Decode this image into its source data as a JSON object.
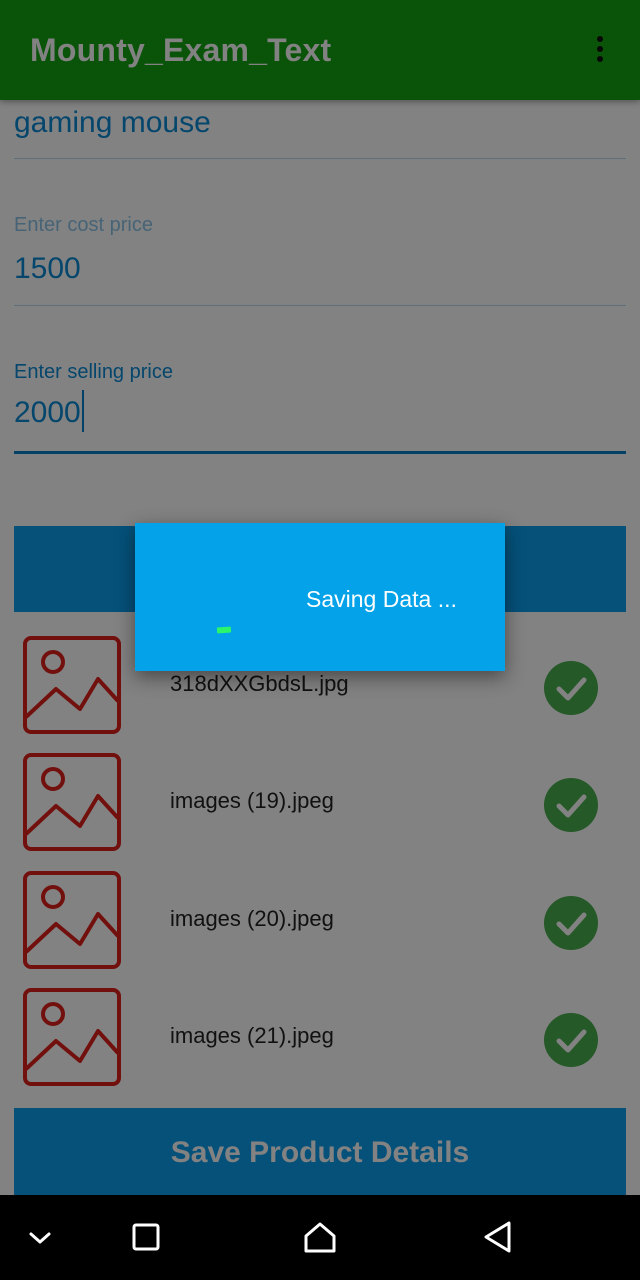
{
  "app_bar": {
    "title": "Mounty_Exam_Text",
    "menu_icon": "more-vert-icon"
  },
  "form": {
    "product_name": {
      "value": "gaming mouse"
    },
    "cost_price": {
      "hint": "Enter cost price",
      "value": "1500"
    },
    "selling_price": {
      "label": "Enter selling price",
      "value": "2000"
    }
  },
  "images": [
    {
      "file": "318dXXGbdsL.jpg",
      "status": "uploaded"
    },
    {
      "file": "images (19).jpeg",
      "status": "uploaded"
    },
    {
      "file": "images (20).jpeg",
      "status": "uploaded"
    },
    {
      "file": "images (21).jpeg",
      "status": "uploaded"
    }
  ],
  "save_button": {
    "label": "Save Product Details"
  },
  "dialog": {
    "message": "Saving Data ..."
  },
  "nav_bar": {
    "buttons": [
      "collapse-icon",
      "recents-icon",
      "home-icon",
      "back-icon"
    ]
  },
  "colors": {
    "app_bar": "#12a512",
    "accent": "#0a9ff0",
    "text_field": "#0b8ad6",
    "image_icon": "#e0201c",
    "check": "#4caf50",
    "dialog": "#04a2e8"
  }
}
